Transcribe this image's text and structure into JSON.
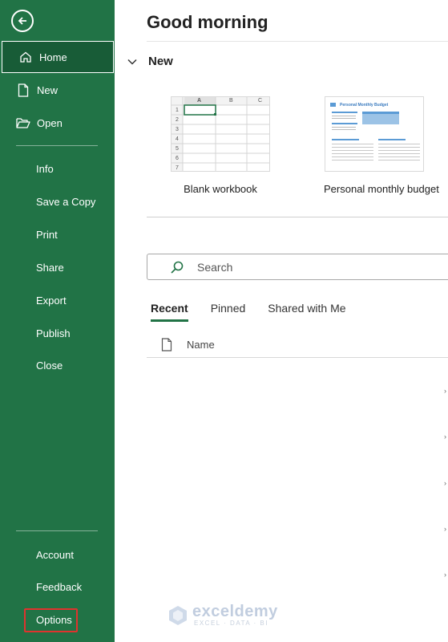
{
  "sidebar": {
    "bg_color": "#217346",
    "active_bg_color": "#185c37",
    "back_icon": "arrow-left-circle-icon",
    "top_items": [
      {
        "label": "Home",
        "icon": "home-icon",
        "active": true
      },
      {
        "label": "New",
        "icon": "document-icon"
      },
      {
        "label": "Open",
        "icon": "folder-open-icon"
      }
    ],
    "middle_items": [
      {
        "label": "Info"
      },
      {
        "label": "Save a Copy"
      },
      {
        "label": "Print"
      },
      {
        "label": "Share"
      },
      {
        "label": "Export"
      },
      {
        "label": "Publish"
      },
      {
        "label": "Close"
      }
    ],
    "bottom_items": [
      {
        "label": "Account"
      },
      {
        "label": "Feedback"
      },
      {
        "label": "Options",
        "highlighted": true,
        "highlight_color": "#e0332e"
      }
    ]
  },
  "main": {
    "greeting": "Good morning",
    "new_section": {
      "label": "New",
      "templates": [
        {
          "label": "Blank workbook",
          "thumbnail": {
            "columns": [
              "A",
              "B",
              "C"
            ],
            "rows": [
              "1",
              "2",
              "3",
              "4",
              "5",
              "6",
              "7"
            ]
          }
        },
        {
          "label": "Personal monthly budget",
          "thumbnail": {
            "title": "Personal Monthly Budget"
          }
        }
      ]
    },
    "search": {
      "placeholder": "Search",
      "icon": "search-icon"
    },
    "tabs": [
      {
        "label": "Recent",
        "active": true
      },
      {
        "label": "Pinned"
      },
      {
        "label": "Shared with Me"
      }
    ],
    "file_list": {
      "header_icon": "file-icon",
      "column_name": "Name"
    }
  },
  "watermark": {
    "name": "exceldemy",
    "tagline": "EXCEL · DATA · BI"
  }
}
